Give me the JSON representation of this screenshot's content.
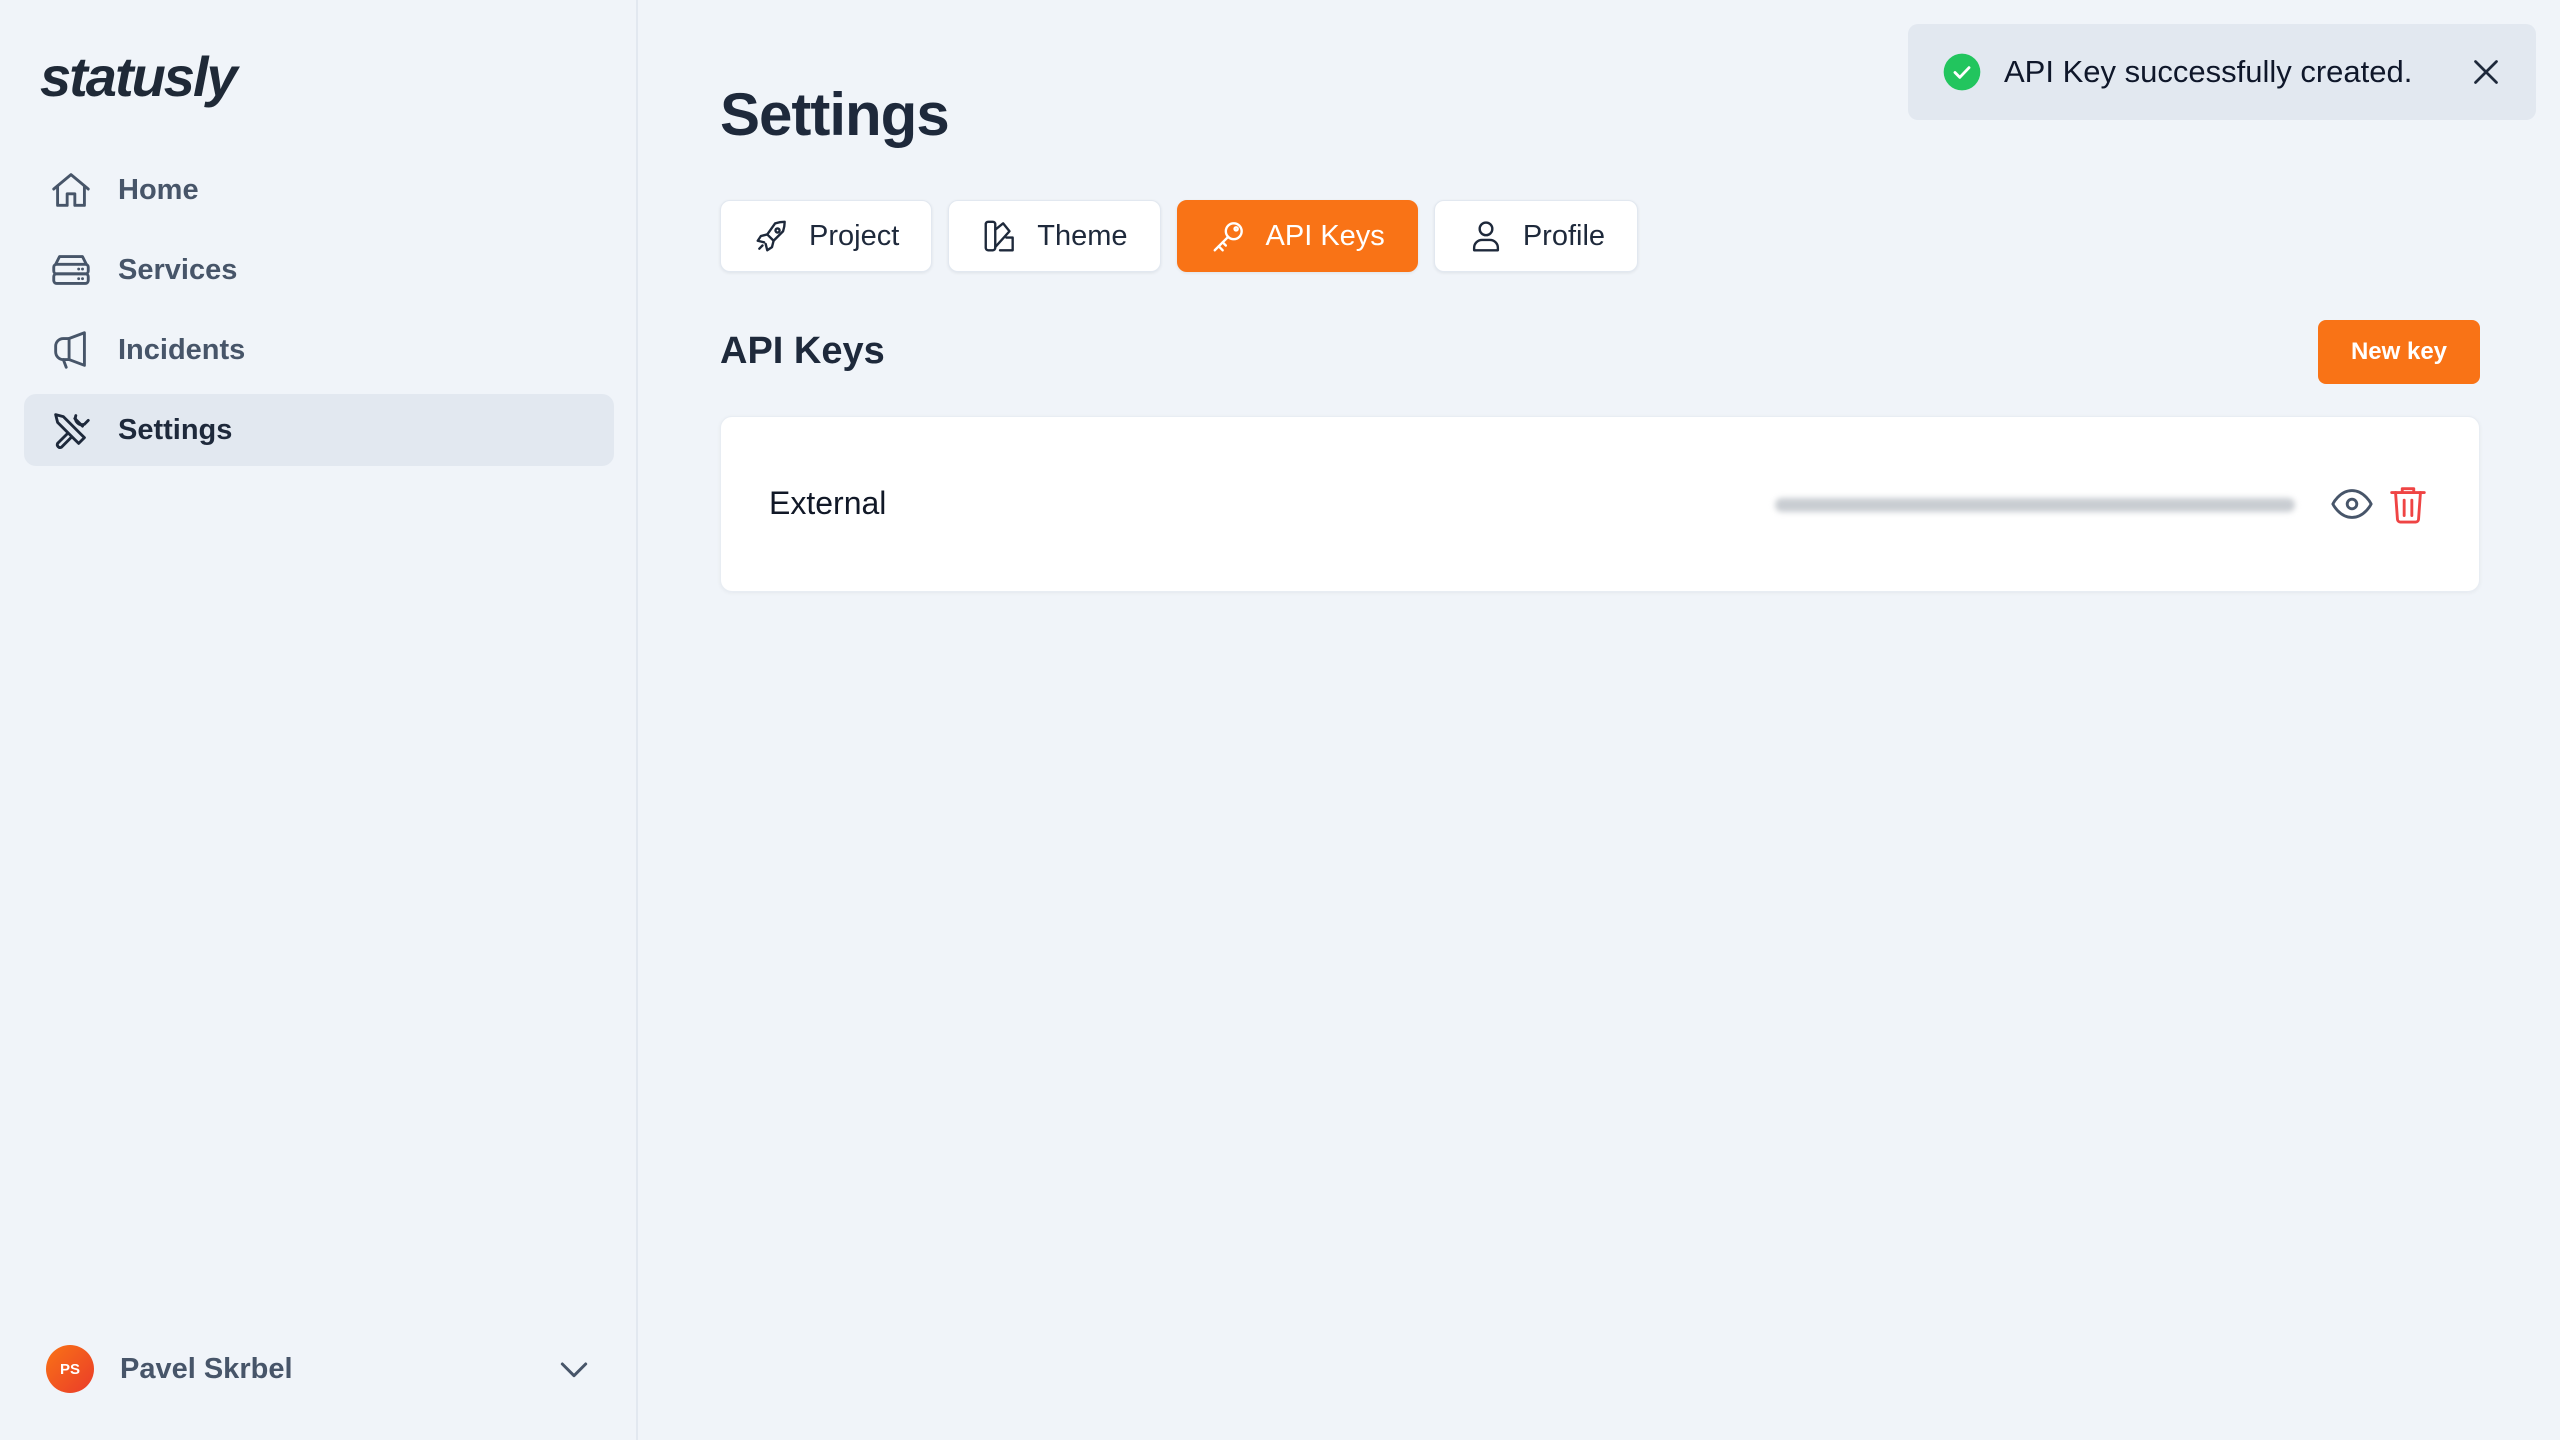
{
  "brand": {
    "logo": "statusly",
    "accent": "#f97316"
  },
  "sidebar": {
    "items": [
      {
        "label": "Home",
        "icon": "home-icon",
        "active": false
      },
      {
        "label": "Services",
        "icon": "server-icon",
        "active": false
      },
      {
        "label": "Incidents",
        "icon": "megaphone-icon",
        "active": false
      },
      {
        "label": "Settings",
        "icon": "tools-icon",
        "active": true
      }
    ],
    "user": {
      "initials": "PS",
      "name": "Pavel Skrbel"
    }
  },
  "main": {
    "title": "Settings",
    "tabs": [
      {
        "label": "Project",
        "icon": "rocket-icon",
        "active": false
      },
      {
        "label": "Theme",
        "icon": "palette-icon",
        "active": false
      },
      {
        "label": "API Keys",
        "icon": "key-icon",
        "active": true
      },
      {
        "label": "Profile",
        "icon": "user-icon",
        "active": false
      }
    ],
    "section_title": "API Keys",
    "new_key_label": "New key",
    "keys": [
      {
        "name": "External",
        "value_hidden": true
      }
    ]
  },
  "toast": {
    "message": "API Key successfully created.",
    "status": "success",
    "status_color": "#22c55e"
  }
}
